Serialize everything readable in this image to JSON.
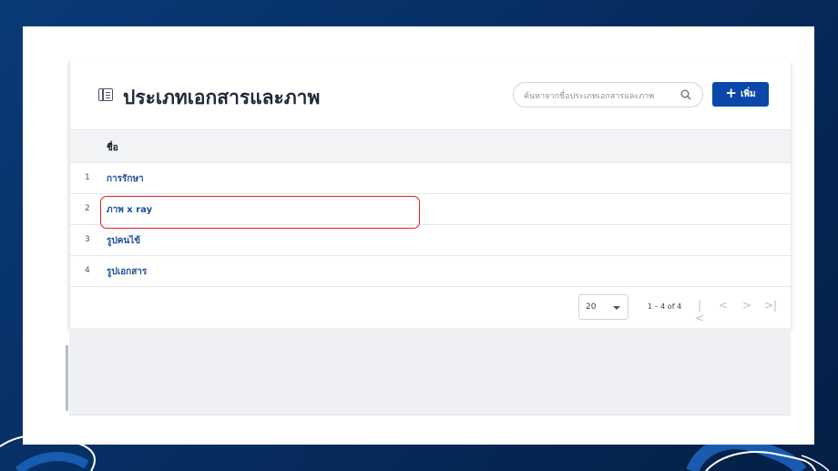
{
  "page": {
    "title": "ประเภทเอกสารและภาพ",
    "search": {
      "placeholder": "ค้นหาจากชื่อประเภทเอกสารและภาพ"
    },
    "add_button_label": "เพิ่ม",
    "table": {
      "columns": [
        "ชื่อ"
      ],
      "rows": [
        {
          "index": "1",
          "name": "การรักษา"
        },
        {
          "index": "2",
          "name": "ภาพ x ray"
        },
        {
          "index": "3",
          "name": "รูปคนไข้"
        },
        {
          "index": "4",
          "name": "รูปเอกสาร"
        }
      ]
    },
    "pagination": {
      "page_size": "20",
      "range_text": "1 – 4 of 4"
    }
  },
  "colors": {
    "accent": "#0a47a8",
    "link": "#1e4e9c",
    "highlight": "#e11d2a",
    "background": "#062e62"
  }
}
